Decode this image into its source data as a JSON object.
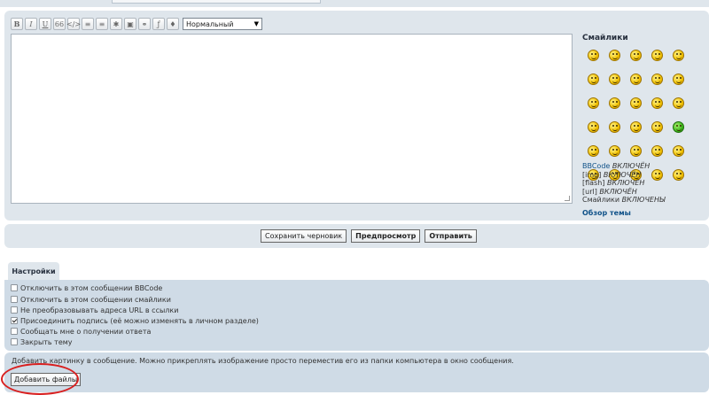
{
  "toolbar": {
    "buttons": [
      {
        "name": "bold-button",
        "glyph": "B",
        "cls": "b"
      },
      {
        "name": "italic-button",
        "glyph": "I",
        "cls": "i"
      },
      {
        "name": "underline-button",
        "glyph": "U",
        "cls": "u"
      },
      {
        "name": "quote-button",
        "glyph": "66",
        "cls": ""
      },
      {
        "name": "code-button",
        "glyph": "</>",
        "cls": ""
      },
      {
        "name": "list-button",
        "glyph": "≡",
        "cls": ""
      },
      {
        "name": "ordered-list-button",
        "glyph": "≡",
        "cls": ""
      },
      {
        "name": "list-item-button",
        "glyph": "✱",
        "cls": ""
      },
      {
        "name": "image-button",
        "glyph": "▣",
        "cls": ""
      },
      {
        "name": "link-button",
        "glyph": "⚭",
        "cls": ""
      },
      {
        "name": "flash-button",
        "glyph": "ƒ",
        "cls": ""
      },
      {
        "name": "color-button",
        "glyph": "♦",
        "cls": ""
      }
    ],
    "font_size_value": "Нормальный"
  },
  "smilies": {
    "title": "Смайлики",
    "icons": [
      "smile",
      "confused",
      "surprised",
      "sad",
      "wink",
      "cool",
      "shocked",
      "angry",
      "evil",
      "mad",
      "lol",
      "razz",
      "rolleyes",
      "idea",
      "arrow",
      "question",
      "exclaim",
      "neutral",
      "twisted",
      "mrgreen",
      "geek",
      "ugeek",
      "eek",
      "hmm",
      "winking",
      "grin",
      "thinking",
      "dance",
      "cry",
      "flag"
    ]
  },
  "status": {
    "bbcode_label": "BBCode",
    "bbcode_value": "ВКЛЮЧЁН",
    "img_label": "[img]",
    "img_value": "ВКЛЮЧЁН",
    "flash_label": "[flash]",
    "flash_value": "ВКЛЮЧЁН",
    "url_label": "[url]",
    "url_value": "ВКЛЮЧЁН",
    "smilies_label": "Смайлики",
    "smilies_value": "ВКЛЮЧЕНЫ"
  },
  "topic_review": "Обзор темы",
  "actions": {
    "save_draft": "Сохранить черновик",
    "preview": "Предпросмотр",
    "submit": "Отправить"
  },
  "options": {
    "tab_label": "Настройки",
    "items": [
      {
        "label": "Отключить в этом сообщении BBCode",
        "checked": false
      },
      {
        "label": "Отключить в этом сообщении смайлики",
        "checked": false
      },
      {
        "label": "Не преобразовывать адреса URL в ссылки",
        "checked": false
      },
      {
        "label": "Присоединить подпись (её можно изменять в личном разделе)",
        "checked": true
      },
      {
        "label": "Сообщать мне о получении ответа",
        "checked": false
      },
      {
        "label": "Закрыть тему",
        "checked": false
      }
    ]
  },
  "attach": {
    "text": "Добавить картинку в сообщение. Можно прикреплять изображение просто переместив его из папки компьютера в окно сообщения.",
    "button": "Добавить файлы"
  }
}
